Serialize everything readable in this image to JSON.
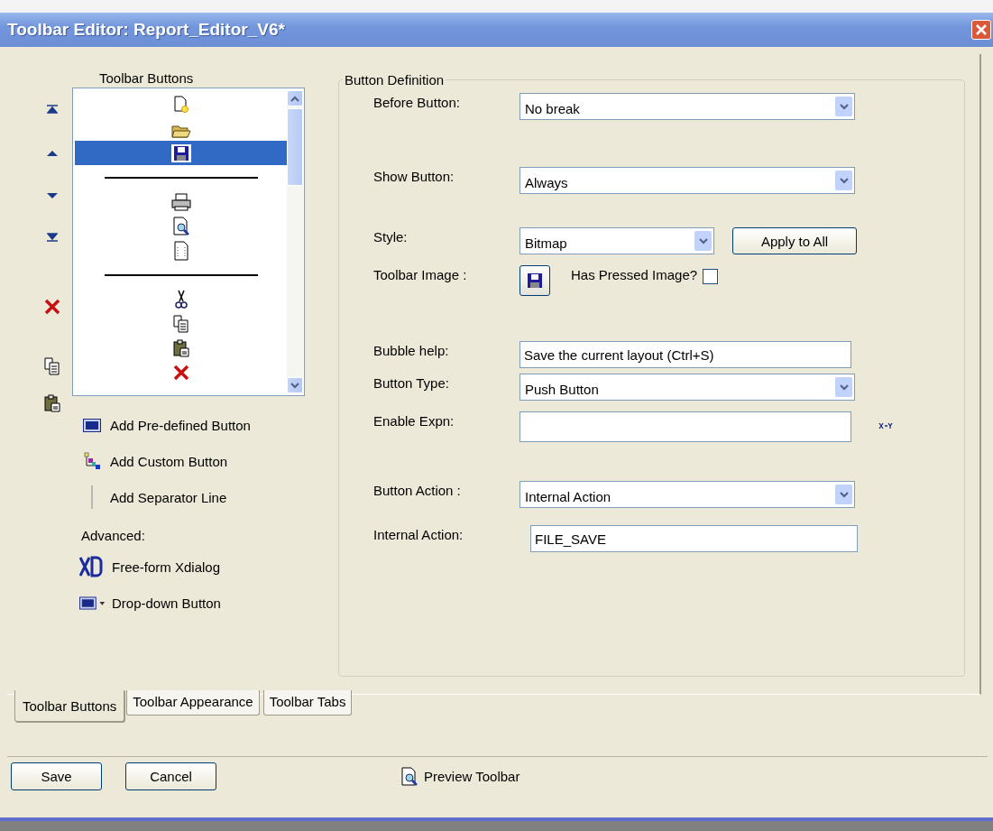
{
  "window": {
    "title": "Toolbar Editor: Report_Editor_V6*"
  },
  "toolbar_buttons": {
    "label": "Toolbar Buttons",
    "items": [
      {
        "kind": "newfile",
        "selected": false
      },
      {
        "kind": "open",
        "selected": false
      },
      {
        "kind": "save",
        "selected": true
      },
      {
        "kind": "separator",
        "selected": false
      },
      {
        "kind": "print",
        "selected": false
      },
      {
        "kind": "preview",
        "selected": false
      },
      {
        "kind": "page",
        "selected": false
      },
      {
        "kind": "separator",
        "selected": false
      },
      {
        "kind": "cut",
        "selected": false
      },
      {
        "kind": "copy",
        "selected": false
      },
      {
        "kind": "paste",
        "selected": false
      },
      {
        "kind": "delete",
        "selected": false
      }
    ]
  },
  "add_actions": [
    {
      "kind": "predefined",
      "label": "Add Pre-defined Button"
    },
    {
      "kind": "custom",
      "label": "Add Custom Button"
    },
    {
      "kind": "separator",
      "label": "Add Separator Line"
    }
  ],
  "advanced": {
    "label": "Advanced:",
    "items": [
      {
        "kind": "xdialog",
        "label": "Free-form Xdialog"
      },
      {
        "kind": "dropdown",
        "label": "Drop-down Button"
      }
    ]
  },
  "button_definition": {
    "title": "Button Definition",
    "fields": [
      {
        "kind": "select",
        "label": "Before Button:",
        "value": "No break"
      },
      {
        "kind": "select",
        "label": "Show Button:",
        "value": "Always"
      },
      {
        "kind": "select",
        "label": "Style:",
        "value": "Bitmap",
        "button": "Apply to All"
      },
      {
        "kind": "image",
        "label": "Toolbar Image :",
        "checkbox": {
          "label": "Has Pressed Image?",
          "checked": false
        }
      },
      {
        "kind": "text",
        "label": "Bubble help:",
        "value": "Save the current layout (Ctrl+S)"
      },
      {
        "kind": "select",
        "label": "Button Type:",
        "value": "Push Button"
      },
      {
        "kind": "expression",
        "label": "Enable Expn:"
      },
      {
        "kind": "select",
        "label": "Button Action :",
        "value": "Internal Action"
      },
      {
        "kind": "text",
        "label": "Internal Action:",
        "value": "FILE_SAVE"
      }
    ]
  },
  "tabs": [
    {
      "label": "Toolbar Buttons",
      "selected": true
    },
    {
      "label": "Toolbar Appearance",
      "selected": false
    },
    {
      "label": "Toolbar Tabs",
      "selected": false
    }
  ],
  "footer": {
    "buttons": [
      "Save",
      "Cancel"
    ],
    "preview": "Preview Toolbar"
  }
}
